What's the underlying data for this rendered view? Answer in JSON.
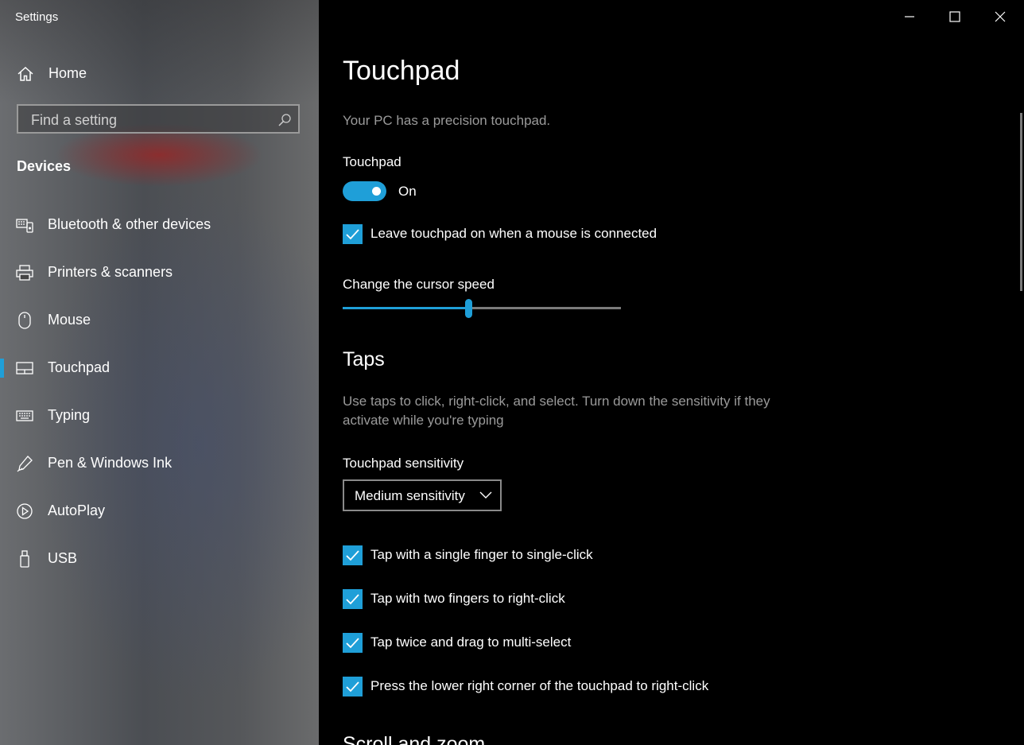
{
  "window": {
    "title": "Settings"
  },
  "sidebar": {
    "home_label": "Home",
    "search_placeholder": "Find a setting",
    "section": "Devices",
    "items": [
      {
        "label": "Bluetooth & other devices",
        "icon": "bluetooth-devices-icon"
      },
      {
        "label": "Printers & scanners",
        "icon": "printer-icon"
      },
      {
        "label": "Mouse",
        "icon": "mouse-icon"
      },
      {
        "label": "Touchpad",
        "icon": "touchpad-icon",
        "active": true
      },
      {
        "label": "Typing",
        "icon": "keyboard-icon"
      },
      {
        "label": "Pen & Windows Ink",
        "icon": "pen-icon"
      },
      {
        "label": "AutoPlay",
        "icon": "autoplay-icon"
      },
      {
        "label": "USB",
        "icon": "usb-icon"
      }
    ]
  },
  "main": {
    "title": "Touchpad",
    "precision_note": "Your PC has a precision touchpad.",
    "touchpad_label": "Touchpad",
    "toggle_state": "On",
    "leave_on_label": "Leave touchpad on when a mouse is connected",
    "leave_on_checked": true,
    "cursor_speed_label": "Change the cursor speed",
    "cursor_speed_fraction": 0.45,
    "taps": {
      "heading": "Taps",
      "description_line1": "Use taps to click, right-click, and select. Turn down the sensitivity if they",
      "description_line2": "activate while you're typing",
      "sensitivity_label": "Touchpad sensitivity",
      "sensitivity_value": "Medium sensitivity",
      "options": [
        {
          "label": "Tap with a single finger to single-click",
          "checked": true
        },
        {
          "label": "Tap with two fingers to right-click",
          "checked": true
        },
        {
          "label": "Tap twice and drag to multi-select",
          "checked": true
        },
        {
          "label": "Press the lower right corner of the touchpad to right-click",
          "checked": true
        }
      ]
    },
    "next_heading": "Scroll and zoom"
  },
  "colors": {
    "accent": "#1f9fd8",
    "background": "#000000",
    "muted_text": "#9a9a9a"
  }
}
